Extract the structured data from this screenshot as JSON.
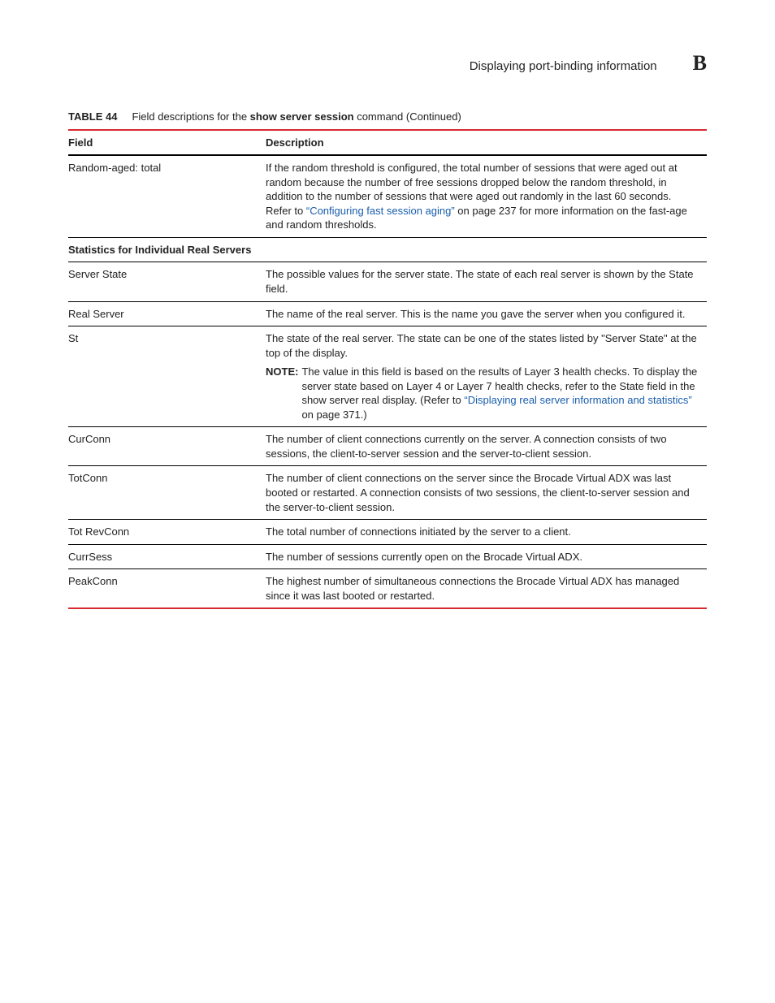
{
  "header": {
    "title": "Displaying port-binding information",
    "letter": "B"
  },
  "table_caption": {
    "num": "TABLE 44",
    "pre": "Field descriptions for the ",
    "cmd": "show server session",
    "post": " command  (Continued)"
  },
  "columns": {
    "field": "Field",
    "description": "Description"
  },
  "rows": {
    "random_aged": {
      "field": "Random-aged: total",
      "desc_pre": "If the random threshold is configured, the total number of sessions that were aged out at random because the number of free sessions dropped below the random threshold, in addition to the number of sessions that were aged out randomly in the last 60 seconds.",
      "refer_pre": "Refer to ",
      "refer_link": "“Configuring fast session aging”",
      "refer_post": " on page 237 for more information on the fast-age and random thresholds."
    },
    "section": {
      "field": "Statistics for Individual Real Servers"
    },
    "server_state": {
      "field": "Server State",
      "desc": "The possible values for the server state. The state of each real server is shown by the State field."
    },
    "real_server": {
      "field": "Real Server",
      "desc": "The name of the real server. This is the name you gave the server when you configured it."
    },
    "st": {
      "field": "St",
      "desc": "The state of the real server. The state can be one of the states listed by \"Server State\" at the top of the display.",
      "note_label": "NOTE:",
      "note_pre": "The value in this field is based on the results of Layer 3 health checks. To display the server state based on Layer 4 or Layer 7 health checks, refer to the State field in the ",
      "note_cmd": "show server real",
      "note_mid": " display. (Refer to ",
      "note_link": "“Displaying real server information and statistics”",
      "note_post": " on page 371.)"
    },
    "curconn": {
      "field": "CurConn",
      "desc": "The number of client connections currently on the server. A connection consists of two sessions, the client-to-server session and the server-to-client session."
    },
    "totconn": {
      "field": "TotConn",
      "desc": "The number of client connections on the server since the Brocade Virtual ADX was last booted or restarted. A connection consists of two sessions, the client-to-server session and the server-to-client session."
    },
    "totrevconn": {
      "field": "Tot RevConn",
      "desc": "The total number of connections initiated by the server to a client."
    },
    "currsess": {
      "field": "CurrSess",
      "desc": "The number of sessions currently open on the Brocade Virtual ADX."
    },
    "peakconn": {
      "field": "PeakConn",
      "desc": "The highest number of simultaneous connections the Brocade Virtual ADX has managed since it was last booted or restarted."
    }
  }
}
